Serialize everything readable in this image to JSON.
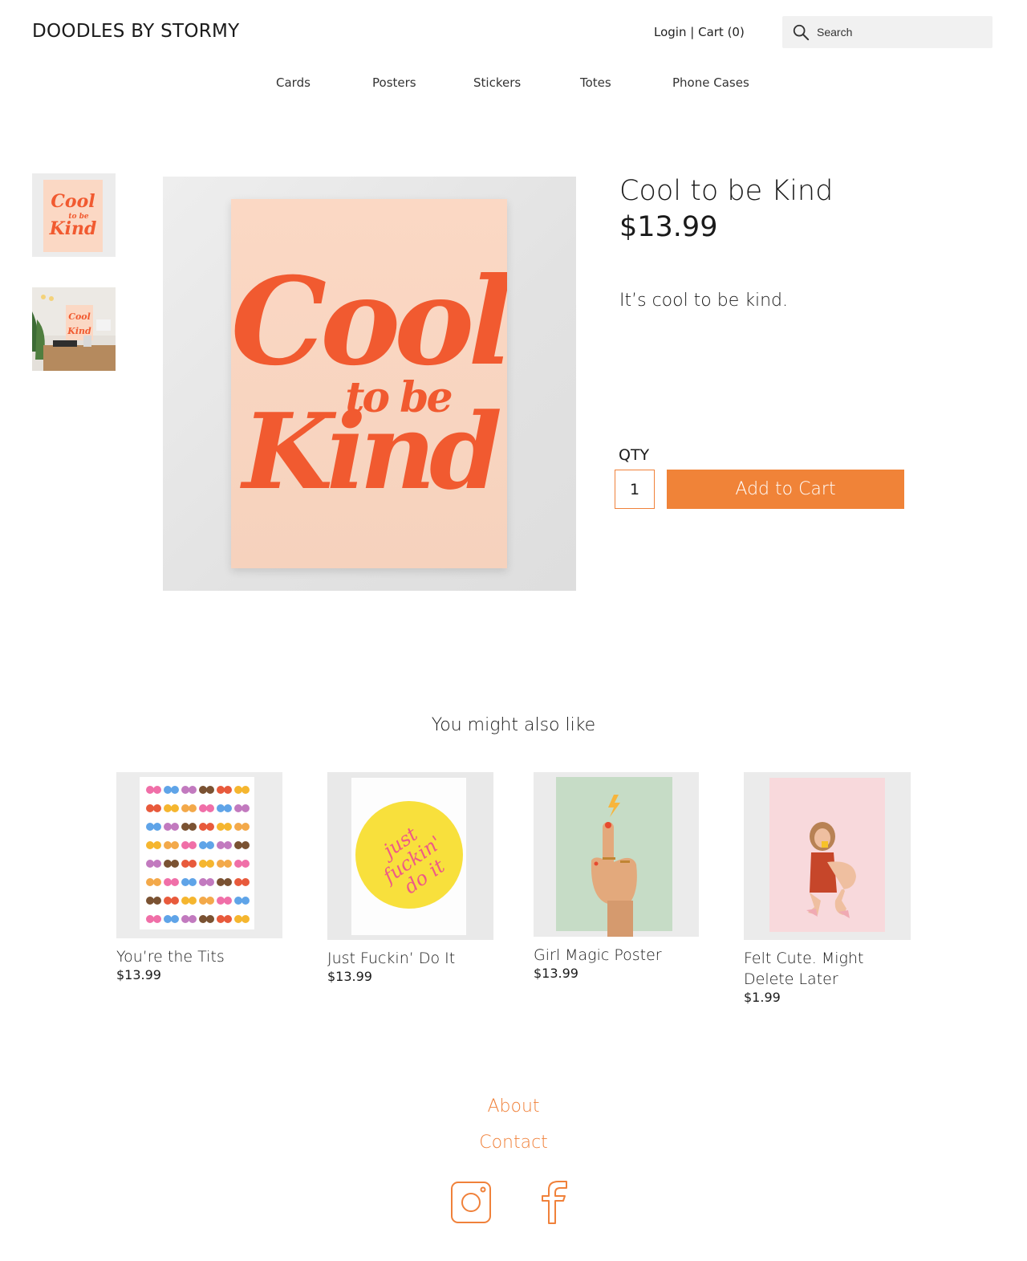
{
  "header": {
    "brand": "DOODLES BY STORMY",
    "login_label": "Login",
    "separator": "|",
    "cart_label": "Cart (0)",
    "search_placeholder": "Search"
  },
  "nav": {
    "items": [
      {
        "label": "Cards"
      },
      {
        "label": "Posters"
      },
      {
        "label": "Stickers"
      },
      {
        "label": "Totes"
      },
      {
        "label": "Phone Cases"
      }
    ]
  },
  "product": {
    "title": "Cool to be Kind",
    "price": "$13.99",
    "description": "It’s cool to be kind.",
    "qty_label": "QTY",
    "qty_value": "1",
    "add_to_cart_label": "Add to Cart",
    "art_text_line1": "Cool",
    "art_text_line2": "to be",
    "art_text_line3": "Kind"
  },
  "related": {
    "heading": "You might also like",
    "items": [
      {
        "name": "You’re the Tits",
        "price": "$13.99"
      },
      {
        "name": "Just Fuckin’ Do It",
        "price": "$13.99",
        "art_text": "just fuckin' do it"
      },
      {
        "name": "Girl Magic Poster",
        "price": "$13.99"
      },
      {
        "name": "Felt Cute. Might Delete Later",
        "price": "$1.99"
      }
    ]
  },
  "footer": {
    "about_label": "About",
    "contact_label": "Contact",
    "instagram_icon": "instagram-icon",
    "facebook_icon": "facebook-icon"
  },
  "colors": {
    "accent": "#f0813a",
    "button": "#f08338",
    "poster_red": "#f15a30",
    "poster_peach": "#fbd8c4"
  }
}
